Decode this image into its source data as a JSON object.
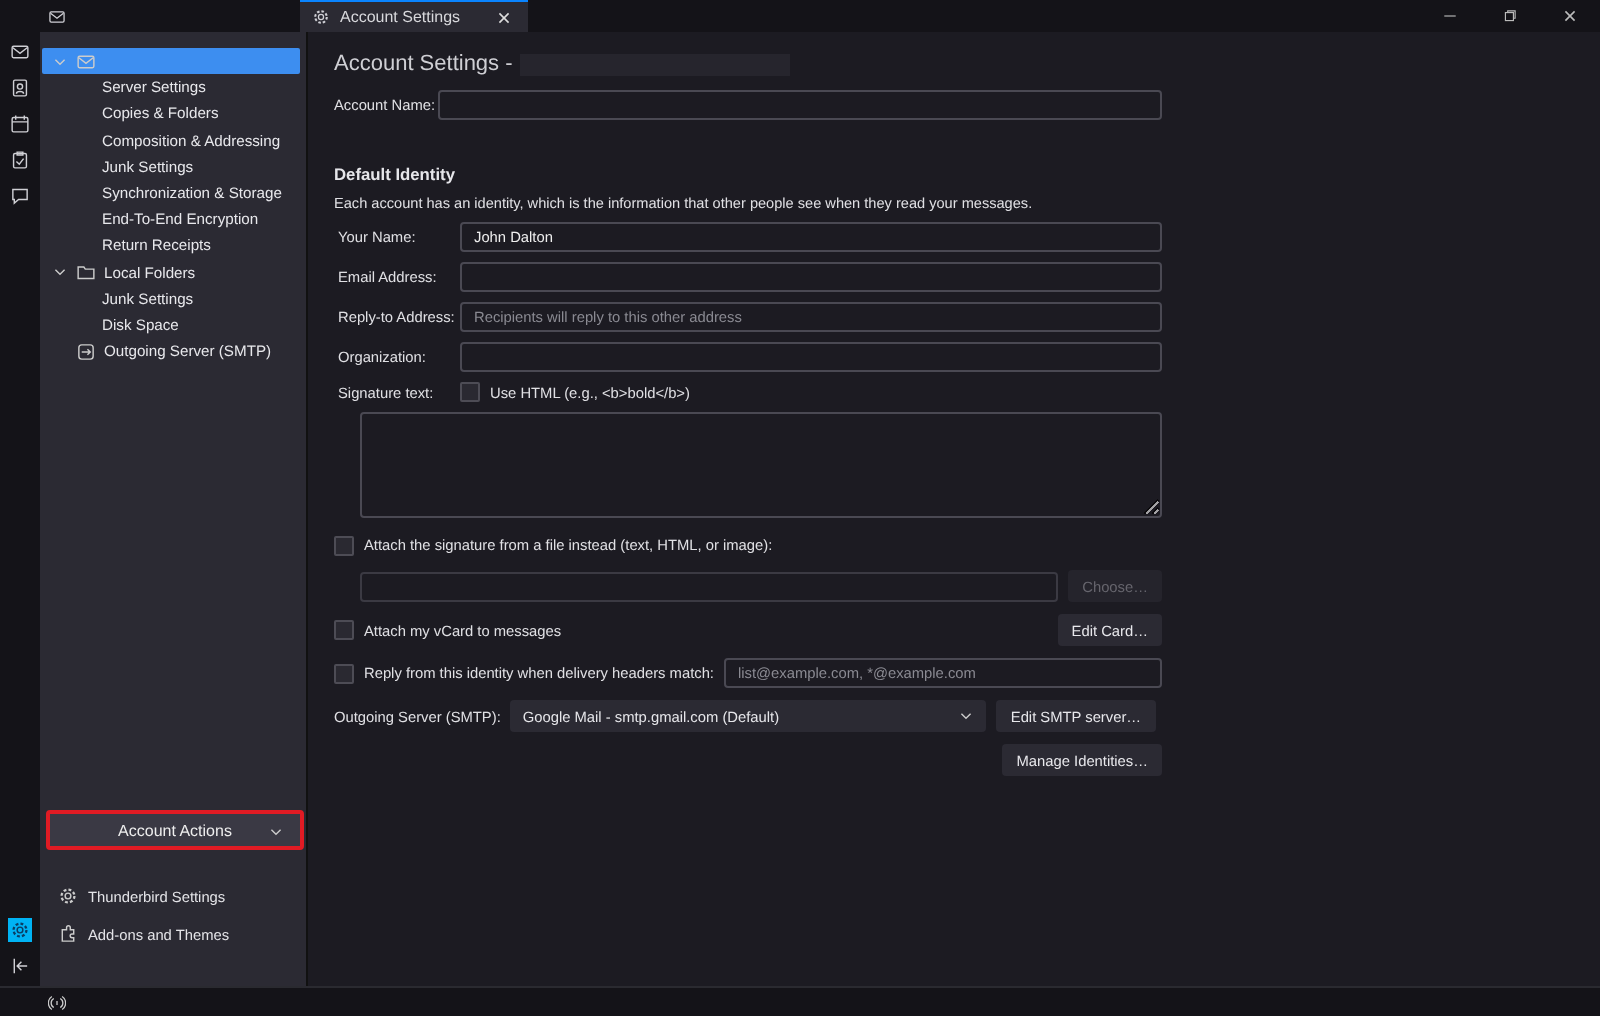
{
  "titlebar": {
    "tabs": [
      {
        "kind": "mail",
        "selected": false
      },
      {
        "kind": "settings",
        "label": "Account Settings",
        "selected": true
      }
    ]
  },
  "spaces": [
    {
      "kind": "mail",
      "selected": false
    },
    {
      "kind": "contacts",
      "selected": false
    },
    {
      "kind": "calendar",
      "selected": false
    },
    {
      "kind": "tasks",
      "selected": false
    },
    {
      "kind": "chat",
      "selected": false
    }
  ],
  "spaces_bottom": [
    {
      "kind": "settings",
      "selected": true
    },
    {
      "kind": "collapse",
      "selected": false
    }
  ],
  "sidebar": {
    "tree": [
      {
        "kind": "account",
        "selected": true,
        "expanded": true,
        "children": [
          {
            "label": "Server Settings",
            "selected": false
          },
          {
            "label": "Copies & Folders",
            "selected": false
          },
          {
            "label": "Composition & Addressing",
            "selected": false
          },
          {
            "label": "Junk Settings",
            "selected": false
          },
          {
            "label": "Synchronization & Storage",
            "selected": false
          },
          {
            "label": "End-To-End Encryption",
            "selected": false
          },
          {
            "label": "Return Receipts",
            "selected": false
          }
        ]
      },
      {
        "kind": "folders",
        "label": "Local Folders",
        "selected": false,
        "expanded": true,
        "children": [
          {
            "label": "Junk Settings",
            "selected": false
          },
          {
            "label": "Disk Space",
            "selected": false
          }
        ]
      },
      {
        "kind": "server",
        "label": "Outgoing Server (SMTP)",
        "selected": false
      }
    ],
    "account_actions": {
      "label": "Account Actions",
      "highlighted": true
    },
    "links": [
      {
        "kind": "settings",
        "label": "Thunderbird Settings"
      },
      {
        "kind": "addons",
        "label": "Add-ons and Themes"
      }
    ]
  },
  "content": {
    "heading": "Account Settings -",
    "account_name": {
      "label": "Account Name:"
    },
    "identity_title": "Default Identity",
    "identity_description": "Each account has an identity, which is the information that other people see when they read your messages.",
    "fields": [
      {
        "label": "Your Name:",
        "value": "John Dalton"
      },
      {
        "label": "Email Address:"
      },
      {
        "label": "Reply-to Address:",
        "placeholder": "Recipients will reply to this other address"
      },
      {
        "label": "Organization:"
      }
    ],
    "signature": {
      "label": "Signature text:",
      "use_html": {
        "label": "Use HTML (e.g., <b>bold</b>)",
        "checked": false
      }
    },
    "attach_file": {
      "label": "Attach the signature from a file instead (text, HTML, or image):",
      "checked": false
    },
    "choose_button": {
      "label": "Choose…",
      "disabled": true
    },
    "vcard": {
      "label": "Attach my vCard to messages",
      "checked": false
    },
    "edit_card": "Edit Card…",
    "reply_from": {
      "label": "Reply from this identity when delivery headers match:",
      "checked": false,
      "placeholder": "list@example.com, *@example.com"
    },
    "outgoing": {
      "label": "Outgoing Server (SMTP):",
      "value": "Google Mail - smtp.gmail.com (Default)"
    },
    "edit_smtp": "Edit SMTP server…",
    "manage": "Manage Identities…"
  },
  "status_bar": {
    "kind": "online"
  }
}
